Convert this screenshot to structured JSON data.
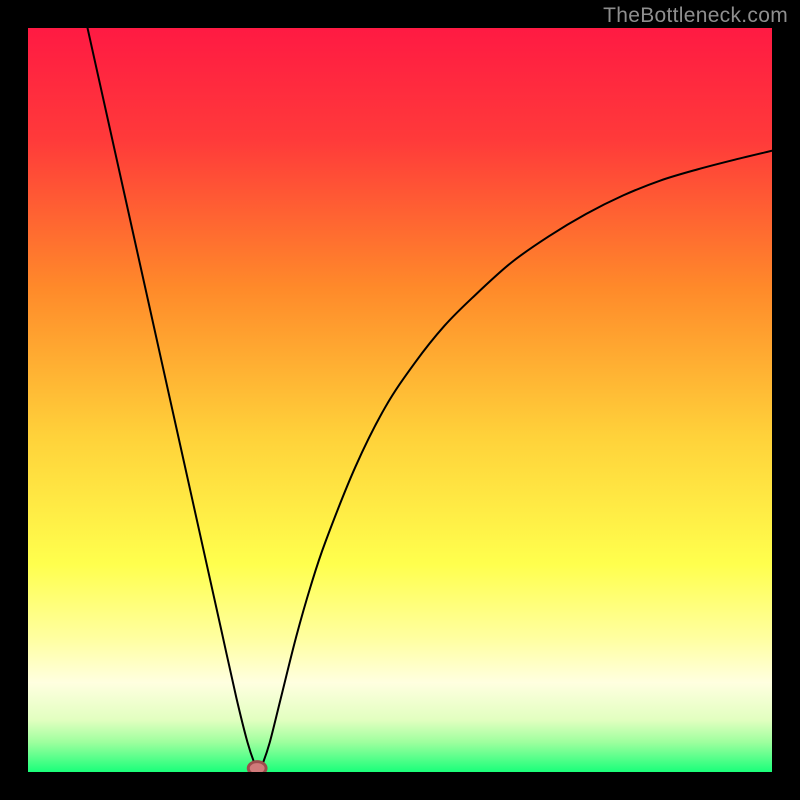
{
  "watermark": "TheBottleneck.com",
  "chart_data": {
    "type": "line",
    "title": "",
    "xlabel": "",
    "ylabel": "",
    "xlim": [
      0,
      100
    ],
    "ylim": [
      0,
      100
    ],
    "grid": false,
    "legend": false,
    "background_gradient": {
      "stops": [
        {
          "offset": 0.0,
          "color": "#ff1a43"
        },
        {
          "offset": 0.15,
          "color": "#ff3a3a"
        },
        {
          "offset": 0.35,
          "color": "#ff8a2a"
        },
        {
          "offset": 0.55,
          "color": "#ffd23a"
        },
        {
          "offset": 0.72,
          "color": "#ffff4d"
        },
        {
          "offset": 0.82,
          "color": "#ffffa0"
        },
        {
          "offset": 0.88,
          "color": "#ffffe0"
        },
        {
          "offset": 0.93,
          "color": "#e2ffc0"
        },
        {
          "offset": 0.96,
          "color": "#9eff9e"
        },
        {
          "offset": 1.0,
          "color": "#1aff7a"
        }
      ]
    },
    "series": [
      {
        "name": "bottleneck-curve",
        "x": [
          8,
          10,
          12,
          14,
          16,
          18,
          20,
          22,
          24,
          26,
          28,
          29.5,
          30.5,
          31,
          31.5,
          32.5,
          34,
          36,
          38,
          40,
          44,
          48,
          52,
          56,
          60,
          65,
          70,
          75,
          80,
          85,
          90,
          95,
          100
        ],
        "y": [
          100,
          91,
          82,
          73,
          64,
          55,
          46,
          37,
          28,
          19,
          10,
          4,
          1,
          0,
          1,
          4,
          10,
          18,
          25,
          31,
          41,
          49,
          55,
          60,
          64,
          68.5,
          72,
          75,
          77.5,
          79.5,
          81,
          82.3,
          83.5
        ]
      }
    ],
    "marker": {
      "name": "optimal-point",
      "x": 30.8,
      "y": 0.5,
      "rx": 1.2,
      "ry": 0.9,
      "color": "#d07a7a"
    }
  }
}
